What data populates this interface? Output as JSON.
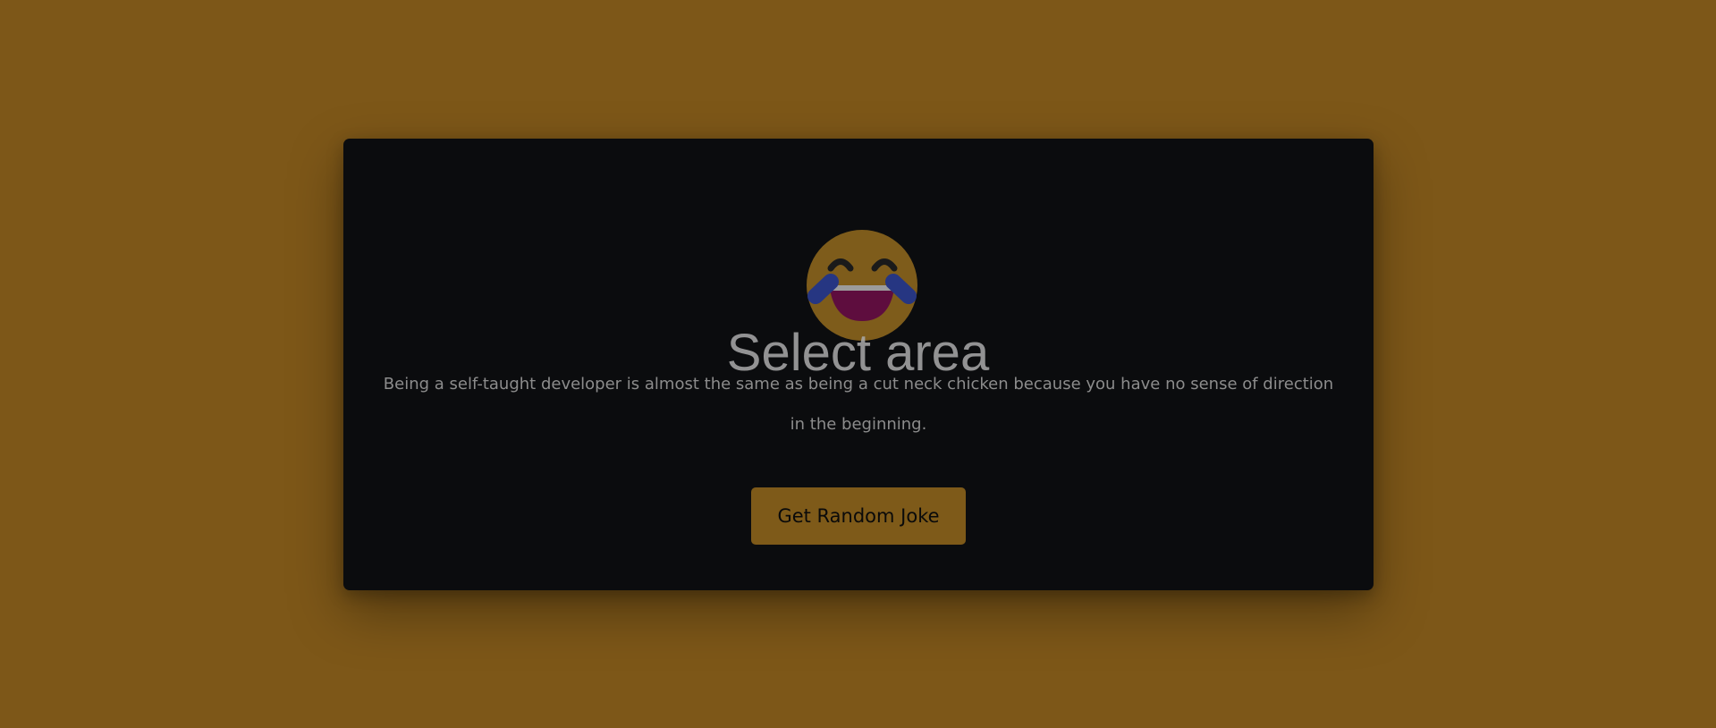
{
  "joke": {
    "emoji_icon": "laughing-with-tears-emoji",
    "text": "Being a self-taught developer is almost the same as being a cut neck chicken because you have no sense of direction in the beginning."
  },
  "button": {
    "label": "Get Random Joke"
  },
  "overlay": {
    "label": "Select area"
  },
  "colors": {
    "background": "#7d5718",
    "card": "#0b0c0e",
    "button": "#7e5a19",
    "text": "#8c8c8c"
  }
}
